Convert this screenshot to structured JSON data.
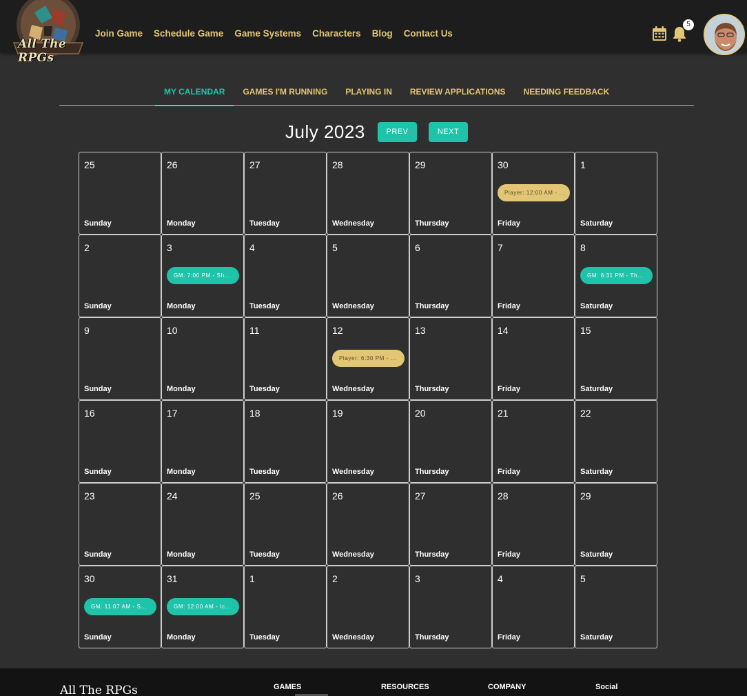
{
  "header": {
    "logo_text": "All The RPGs",
    "nav": [
      "Join Game",
      "Schedule Game",
      "Game Systems",
      "Characters",
      "Blog",
      "Contact Us"
    ],
    "notification_count": "5",
    "icons": [
      "calendar-icon",
      "bell-icon",
      "avatar"
    ]
  },
  "tabs": [
    {
      "label": "MY CALENDAR",
      "active": true
    },
    {
      "label": "GAMES I'M RUNNING",
      "active": false
    },
    {
      "label": "PLAYING IN",
      "active": false
    },
    {
      "label": "REVIEW APPLICATIONS",
      "active": false
    },
    {
      "label": "NEEDING FEEDBACK",
      "active": false
    }
  ],
  "calendar": {
    "month_label": "July 2023",
    "prev_label": "PREV",
    "next_label": "NEXT",
    "weeks": [
      [
        {
          "day": "25",
          "name": "Sunday"
        },
        {
          "day": "26",
          "name": "Monday"
        },
        {
          "day": "27",
          "name": "Tuesday"
        },
        {
          "day": "28",
          "name": "Wednesday"
        },
        {
          "day": "29",
          "name": "Thursday"
        },
        {
          "day": "30",
          "name": "Friday",
          "event": {
            "type": "player",
            "text": "Player: 12:00 AM - ..."
          }
        },
        {
          "day": "1",
          "name": "Saturday"
        }
      ],
      [
        {
          "day": "2",
          "name": "Sunday"
        },
        {
          "day": "3",
          "name": "Monday",
          "event": {
            "type": "gm",
            "text": "GM: 7:00 PM - Sh..."
          }
        },
        {
          "day": "4",
          "name": "Tuesday"
        },
        {
          "day": "5",
          "name": "Wednesday"
        },
        {
          "day": "6",
          "name": "Thursday"
        },
        {
          "day": "7",
          "name": "Friday"
        },
        {
          "day": "8",
          "name": "Saturday",
          "event": {
            "type": "gm",
            "text": "GM: 6:31 PM - Th..."
          }
        }
      ],
      [
        {
          "day": "9",
          "name": "Sunday"
        },
        {
          "day": "10",
          "name": "Monday"
        },
        {
          "day": "11",
          "name": "Tuesday"
        },
        {
          "day": "12",
          "name": "Wednesday",
          "event": {
            "type": "player",
            "text": "Player: 6:30 PM - ..."
          }
        },
        {
          "day": "13",
          "name": "Thursday"
        },
        {
          "day": "14",
          "name": "Friday"
        },
        {
          "day": "15",
          "name": "Saturday"
        }
      ],
      [
        {
          "day": "16",
          "name": "Sunday"
        },
        {
          "day": "17",
          "name": "Monday"
        },
        {
          "day": "18",
          "name": "Tuesday"
        },
        {
          "day": "19",
          "name": "Wednesday"
        },
        {
          "day": "20",
          "name": "Thursday"
        },
        {
          "day": "21",
          "name": "Friday"
        },
        {
          "day": "22",
          "name": "Saturday"
        }
      ],
      [
        {
          "day": "23",
          "name": "Sunday"
        },
        {
          "day": "24",
          "name": "Monday"
        },
        {
          "day": "25",
          "name": "Tuesday"
        },
        {
          "day": "26",
          "name": "Wednesday"
        },
        {
          "day": "27",
          "name": "Thursday"
        },
        {
          "day": "28",
          "name": "Friday"
        },
        {
          "day": "29",
          "name": "Saturday"
        }
      ],
      [
        {
          "day": "30",
          "name": "Sunday",
          "event": {
            "type": "gm",
            "text": "GM: 11:07 AM - S..."
          }
        },
        {
          "day": "31",
          "name": "Monday",
          "event": {
            "type": "gm",
            "text": "GM: 12:00 AM - Ic..."
          }
        },
        {
          "day": "1",
          "name": "Tuesday"
        },
        {
          "day": "2",
          "name": "Wednesday"
        },
        {
          "day": "3",
          "name": "Thursday"
        },
        {
          "day": "4",
          "name": "Friday"
        },
        {
          "day": "5",
          "name": "Saturday"
        }
      ]
    ]
  },
  "footer": {
    "brand": "All The RPGs",
    "columns": [
      "GAMES",
      "RESOURCES",
      "COMPANY",
      "Social"
    ]
  },
  "colors": {
    "accent": "#1fc3aa",
    "gold": "#e3c576",
    "background": "#2f2f2f",
    "header": "#1d1d1d"
  }
}
